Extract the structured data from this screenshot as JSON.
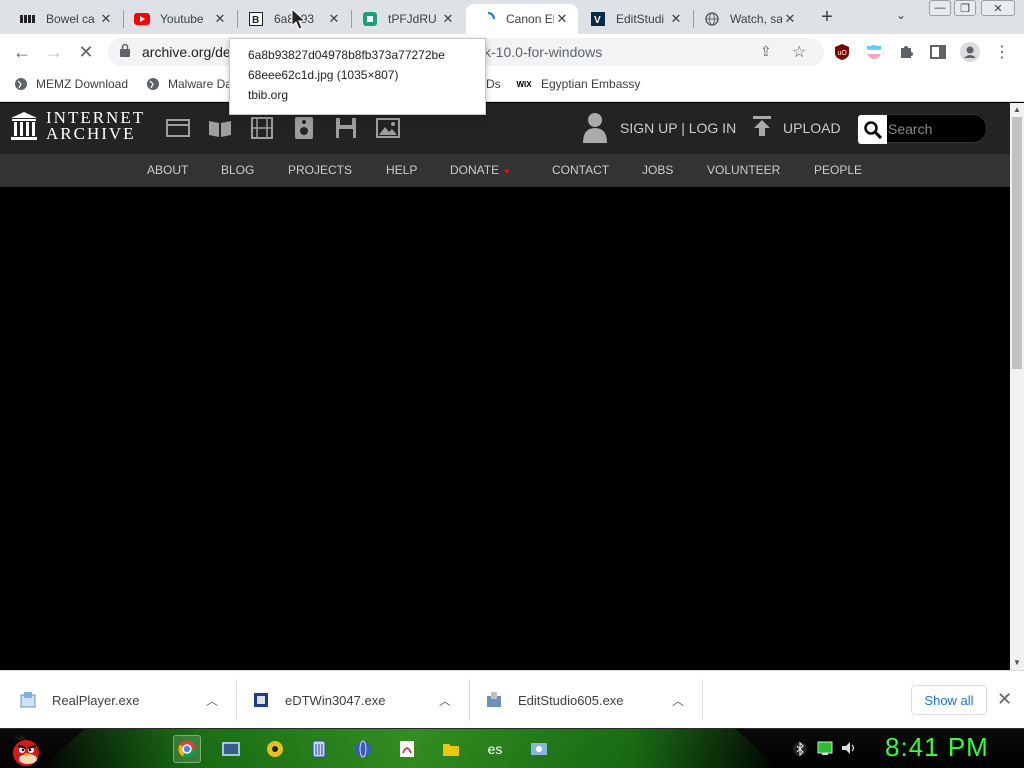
{
  "browser": {
    "tabs": [
      {
        "title": "Bowel ca",
        "favicon": "memz-icon",
        "active": false
      },
      {
        "title": "Youtube",
        "favicon": "youtube-icon",
        "active": false
      },
      {
        "title": "6a8b93",
        "favicon": "b-icon",
        "active": false
      },
      {
        "title": "tPFJdRU",
        "favicon": "green-square-icon",
        "active": false
      },
      {
        "title": "Canon El",
        "favicon": "loading-spinner-icon",
        "active": true
      },
      {
        "title": "EditStudi",
        "favicon": "v-icon",
        "active": false
      },
      {
        "title": "Watch, sa",
        "favicon": "globe-icon",
        "active": false
      }
    ],
    "new_tab": "+",
    "url_host": "archive.org/de",
    "url_rest": "k-10.0-for-windows",
    "bookmarks": [
      {
        "label": "MEMZ Download",
        "icon": "globe-icon"
      },
      {
        "label": "Malware Da",
        "icon": "globe-icon"
      },
      {
        "label": "Ds",
        "icon": ""
      },
      {
        "label": "Egyptian Embassy",
        "icon": "wix-icon",
        "icon_text": "WIX"
      }
    ]
  },
  "tooltip": {
    "line1": "6a8b93827d04978b8fb373a77272be",
    "line2": "68eee62c1d.jpg (1035×807)",
    "line3": "tbib.org"
  },
  "archive": {
    "logo_line1": "INTERNET",
    "logo_line2": "ARCHIVE",
    "signin": "SIGN UP | LOG IN",
    "upload": "UPLOAD",
    "search_placeholder": "Search",
    "nav": [
      "ABOUT",
      "BLOG",
      "PROJECTS",
      "HELP",
      "DONATE",
      "CONTACT",
      "JOBS",
      "VOLUNTEER",
      "PEOPLE"
    ]
  },
  "downloads": {
    "items": [
      "RealPlayer.exe",
      "eDTWin3047.exe",
      "EditStudio605.exe"
    ],
    "show_all": "Show all"
  },
  "taskbar": {
    "clock": "8:41 PM",
    "es_label": "es"
  },
  "colors": {
    "clock": "#33ff33",
    "donate_heart": "#ff0000",
    "ia_header": "#232323",
    "ia_nav": "#333333"
  }
}
